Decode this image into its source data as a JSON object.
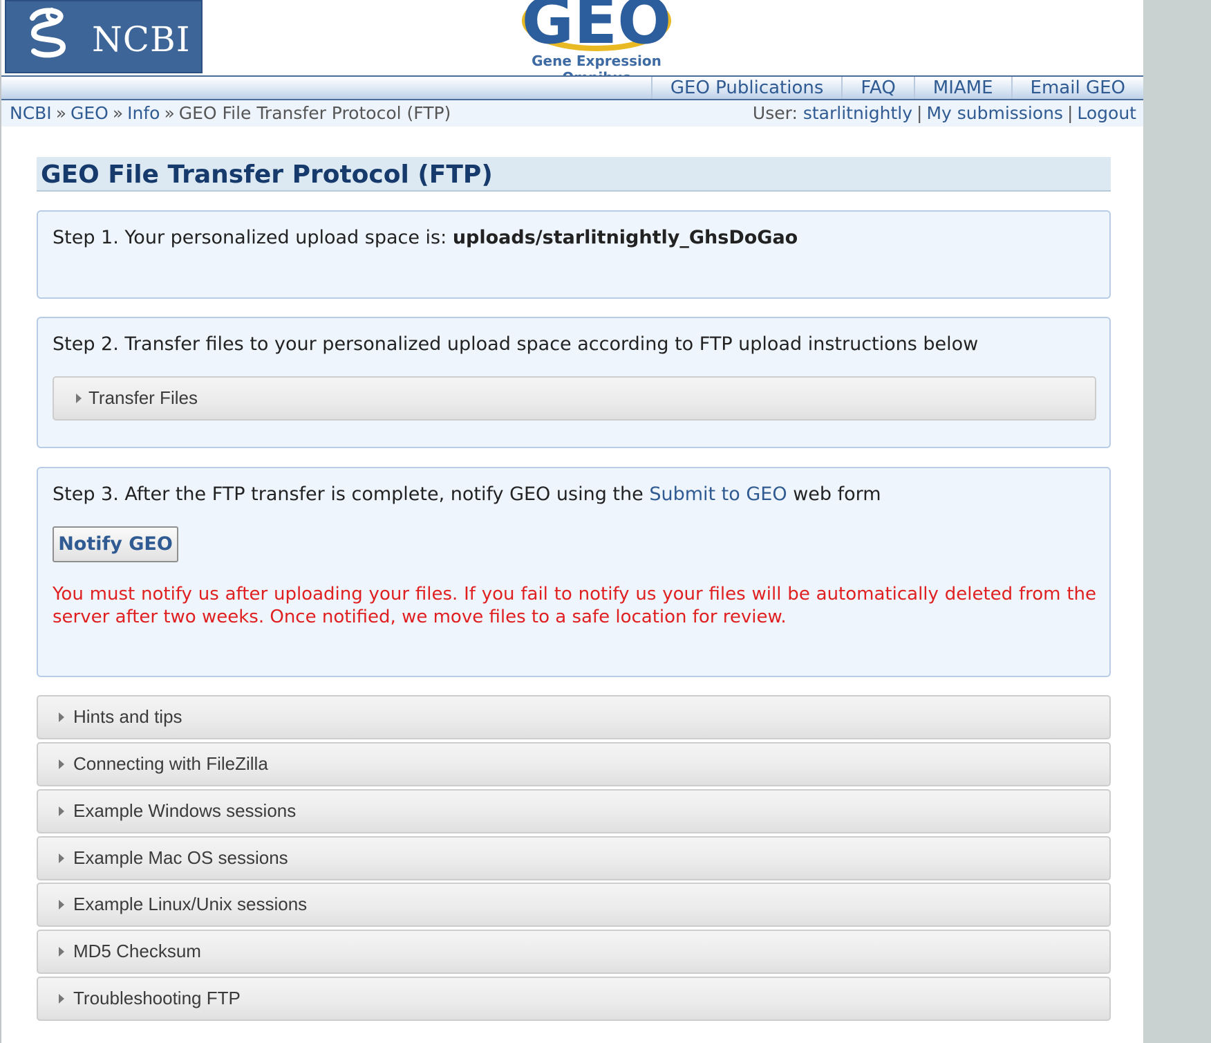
{
  "header": {
    "ncbi_logo_text": "NCBI",
    "geo_logo_text": "GEO",
    "geo_tagline": "Gene Expression Omnibus"
  },
  "topnav": {
    "items": [
      "GEO Publications",
      "FAQ",
      "MIAME",
      "Email GEO"
    ]
  },
  "breadcrumb": {
    "items": [
      "NCBI",
      "GEO",
      "Info"
    ],
    "current": "GEO File Transfer Protocol (FTP)",
    "separator": "»"
  },
  "user": {
    "label": "User:",
    "username": "starlitnightly",
    "my_submissions": "My submissions",
    "logout": "Logout",
    "separator": "|"
  },
  "page_title": "GEO File Transfer Protocol (FTP)",
  "step1": {
    "text": "Step 1. Your personalized upload space is: ",
    "upload_space": "uploads/starlitnightly_GhsDoGao"
  },
  "step2": {
    "text": "Step 2. Transfer files to your personalized upload space according to FTP upload instructions below",
    "collapsible_label": "Transfer Files"
  },
  "step3": {
    "text_before": "Step 3. After the FTP transfer is complete, notify GEO using the ",
    "link_text": "Submit to GEO",
    "text_after": " web form",
    "button_label": "Notify GEO",
    "warning": "You must notify us after uploading your files. If you fail to notify us your files will be automatically deleted from the server after two weeks. Once notified, we move files to a safe location for review."
  },
  "sections": [
    "Hints and tips",
    "Connecting with FileZilla",
    "Example Windows sessions",
    "Example Mac OS sessions",
    "Example Linux/Unix sessions",
    "MD5 Checksum",
    "Troubleshooting FTP"
  ],
  "colors": {
    "link": "#2f5a92",
    "title": "#153a6b",
    "warning": "#e02020",
    "panel_bg": "#eef5fd"
  }
}
